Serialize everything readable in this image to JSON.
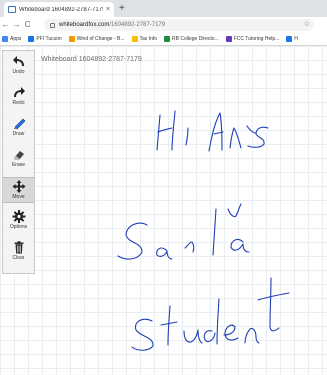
{
  "browser": {
    "tab_title": "Whiteboard 1604892-2787-7179",
    "tab_close": "×",
    "new_tab": "+",
    "nav": {
      "back": "←",
      "forward": "→",
      "reload": "C"
    },
    "url_host": "whiteboardfox.com",
    "url_path": "/1604892-2787-7179",
    "star": "☆",
    "bookmarks": [
      {
        "label": "Apps",
        "color": "#4285f4"
      },
      {
        "label": "PFI Tucson",
        "color": "#1a73e8"
      },
      {
        "label": "Wind of Change - B...",
        "color": "#f29900"
      },
      {
        "label": "Tax Info",
        "color": "#fbbc04"
      },
      {
        "label": "RB College Directo...",
        "color": "#1e8e3e"
      },
      {
        "label": "FCC Tutoring Help...",
        "color": "#673ab7"
      },
      {
        "label": "H",
        "color": "#1a73e8"
      }
    ]
  },
  "whiteboard": {
    "title": "Whiteboard 1604892-2787-7179",
    "tools": [
      {
        "label": "Undo",
        "icon": "undo-icon"
      },
      {
        "label": "Redo",
        "icon": "redo-icon"
      },
      {
        "label": "Draw",
        "icon": "pen-icon"
      },
      {
        "label": "Erase",
        "icon": "eraser-icon"
      },
      {
        "label": "Move",
        "icon": "move-icon",
        "active": true
      },
      {
        "label": "Options",
        "icon": "gear-icon"
      },
      {
        "label": "Clear",
        "icon": "trash-icon"
      }
    ],
    "ink_color": "#1f3fb5"
  }
}
